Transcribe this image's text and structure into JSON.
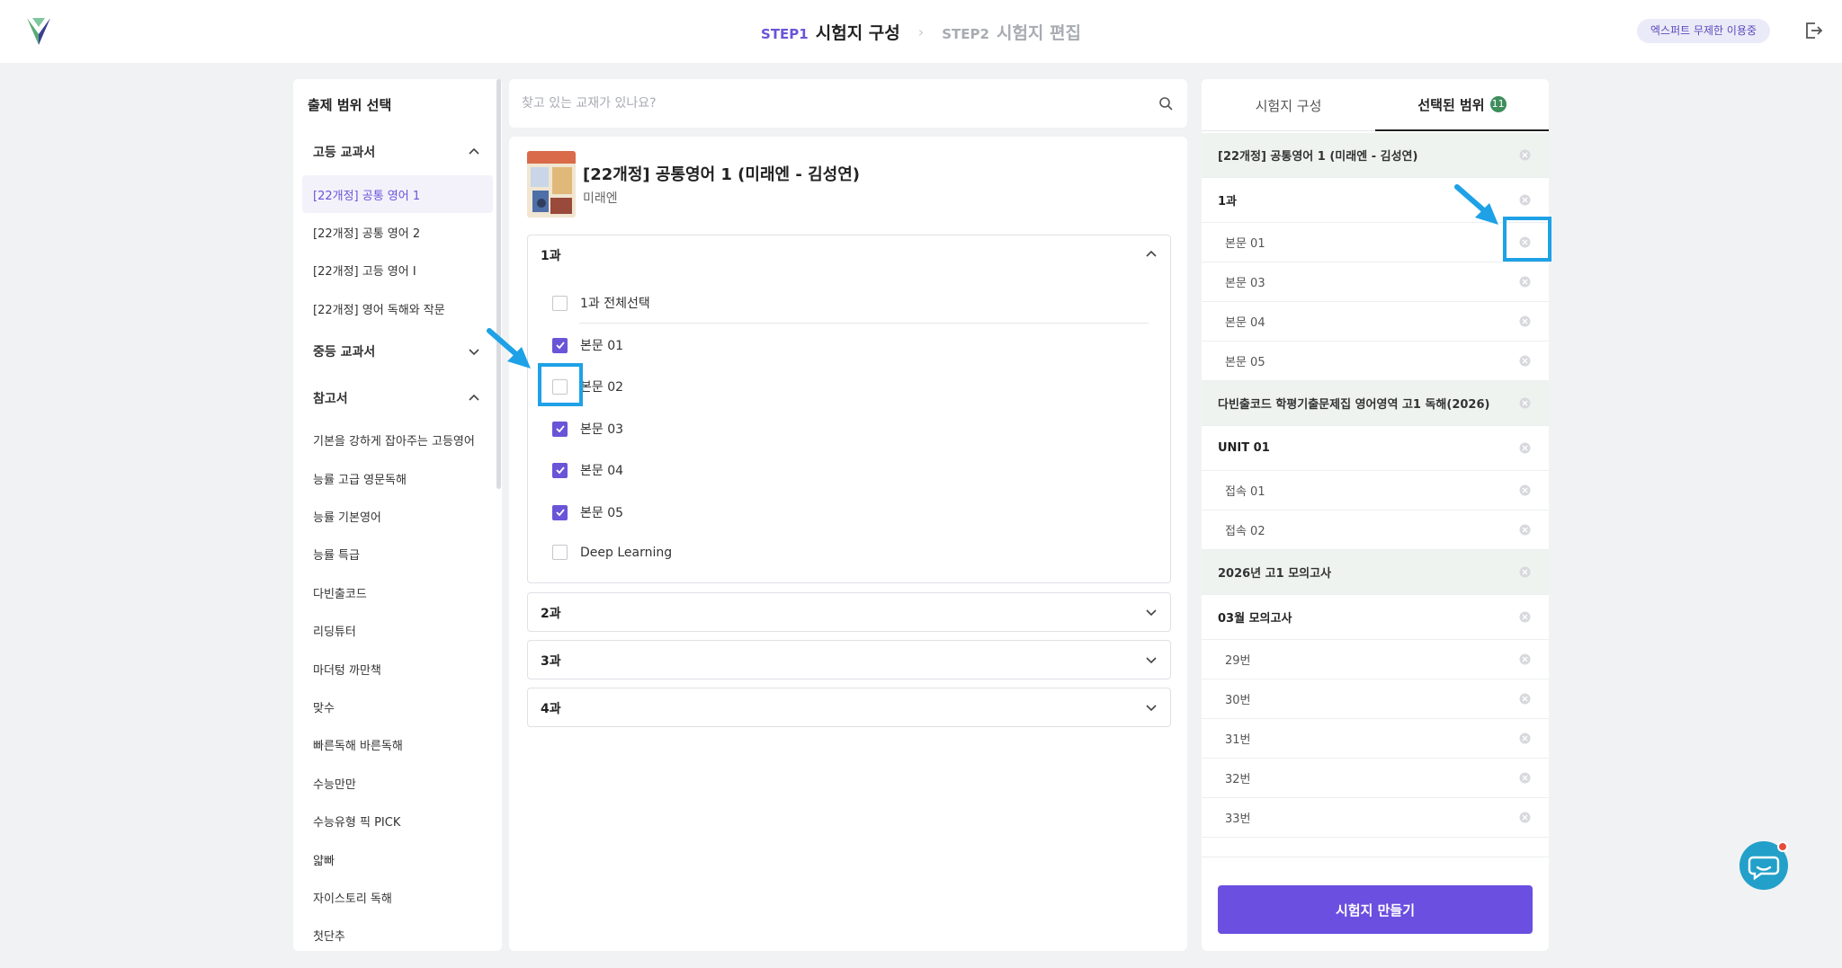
{
  "header": {
    "step1": {
      "no": "STEP1",
      "name": "시험지 구성"
    },
    "step2": {
      "no": "STEP2",
      "name": "시험지 편집"
    },
    "user_badge": "엑스퍼트 무제한 이용중"
  },
  "left": {
    "title": "출제 범위 선택",
    "sections": [
      {
        "label": "고등 교과서",
        "expanded": true,
        "items": [
          "[22개정] 공통 영어 1",
          "[22개정] 공통 영어 2",
          "[22개정] 고등 영어 I",
          "[22개정] 영어 독해와 작문"
        ]
      },
      {
        "label": "중등 교과서",
        "expanded": false
      },
      {
        "label": "참고서",
        "expanded": true,
        "items": [
          "기본을 강하게 잡아주는 고등영어",
          "능률 고급 영문독해",
          "능률 기본영어",
          "능률 특급",
          "다빈출코드",
          "리딩튜터",
          "마더텅 까만책",
          "맞수",
          "빠른독해 바른독해",
          "수능만만",
          "수능유형 픽 PICK",
          "얇빠",
          "자이스토리 독해",
          "첫단추"
        ]
      }
    ]
  },
  "search": {
    "placeholder": "찾고 있는 교재가 있나요?"
  },
  "book": {
    "title": "[22개정] 공통영어 1 (미래엔 - 김성연)",
    "publisher": "미래엔"
  },
  "lessons": {
    "l1": {
      "label": "1과",
      "select_all": "1과 전체선택",
      "items": [
        {
          "label": "본문 01",
          "checked": true
        },
        {
          "label": "본문 02",
          "checked": false
        },
        {
          "label": "본문 03",
          "checked": true
        },
        {
          "label": "본문 04",
          "checked": true
        },
        {
          "label": "본문 05",
          "checked": true
        },
        {
          "label": "Deep Learning",
          "checked": false
        }
      ]
    },
    "l2": "2과",
    "l3": "3과",
    "l4": "4과"
  },
  "right": {
    "tab_compose": "시험지 구성",
    "tab_selected": "선택된 범위",
    "selected_count": "11",
    "rows": [
      {
        "type": "book",
        "label": "[22개정] 공통영어 1 (미래엔 - 김성연)"
      },
      {
        "type": "chapter",
        "label": "1과"
      },
      {
        "type": "item",
        "label": "본문 01"
      },
      {
        "type": "item",
        "label": "본문 03"
      },
      {
        "type": "item",
        "label": "본문 04"
      },
      {
        "type": "item",
        "label": "본문 05"
      },
      {
        "type": "book",
        "label": "다빈출코드 학평기출문제집 영어영역 고1 독해(2026)"
      },
      {
        "type": "chapter",
        "label": "UNIT 01"
      },
      {
        "type": "item",
        "label": "접속 01"
      },
      {
        "type": "item",
        "label": "접속 02"
      },
      {
        "type": "book",
        "label": "2026년 고1 모의고사"
      },
      {
        "type": "chapter",
        "label": "03월 모의고사"
      },
      {
        "type": "item",
        "label": "29번"
      },
      {
        "type": "item",
        "label": "30번"
      },
      {
        "type": "item",
        "label": "31번"
      },
      {
        "type": "item",
        "label": "32번"
      },
      {
        "type": "item",
        "label": "33번"
      }
    ],
    "make_button": "시험지 만들기"
  },
  "colors": {
    "accent": "#6a54d8",
    "button": "#6a4fe0",
    "annotation": "#1ea1e6",
    "count_badge": "#3f8e5c"
  },
  "icons": [
    "logo-icon",
    "logout-icon",
    "search-icon",
    "chevron-up-icon",
    "chevron-down-icon",
    "check-icon",
    "remove-x-icon",
    "chat-icon"
  ]
}
